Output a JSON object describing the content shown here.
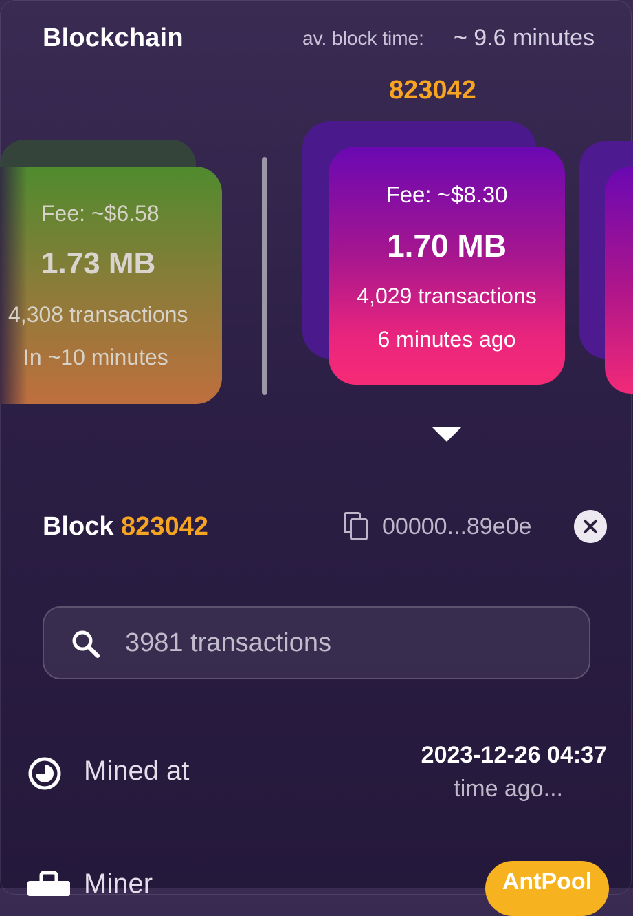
{
  "header": {
    "title": "Blockchain",
    "avg_block_time_label": "av. block time:",
    "avg_block_time_value": "~ 9.6 minutes",
    "current_height": "823042"
  },
  "mempool_block": {
    "fee": "Fee: ~$6.58",
    "size": "1.73 MB",
    "transactions": "4,308 transactions",
    "eta": "In ~10 minutes"
  },
  "mined_block": {
    "fee": "Fee: ~$8.30",
    "size": "1.70 MB",
    "transactions": "4,029 transactions",
    "time_ago": "6 minutes ago"
  },
  "block_details": {
    "label": "Block",
    "number": "823042",
    "hash_short": "00000...89e0e",
    "search_placeholder": "3981 transactions",
    "mined_at_label": "Mined at",
    "mined_at_value": "2023-12-26 04:37",
    "mined_at_relative": "time ago...",
    "miner_label": "Miner",
    "miner_value": "AntPool"
  },
  "colors": {
    "accent": "#f7a521",
    "background": "#2c1f45",
    "mined_block_top": "#6a08b3",
    "mined_block_bottom": "#f62b76",
    "mempool_top": "#4f8b2e",
    "mempool_bottom": "#bf6f3e"
  },
  "icons": [
    "copy-icon",
    "close-icon",
    "search-icon",
    "clock-icon",
    "miner-icon",
    "down-pointer-icon"
  ]
}
